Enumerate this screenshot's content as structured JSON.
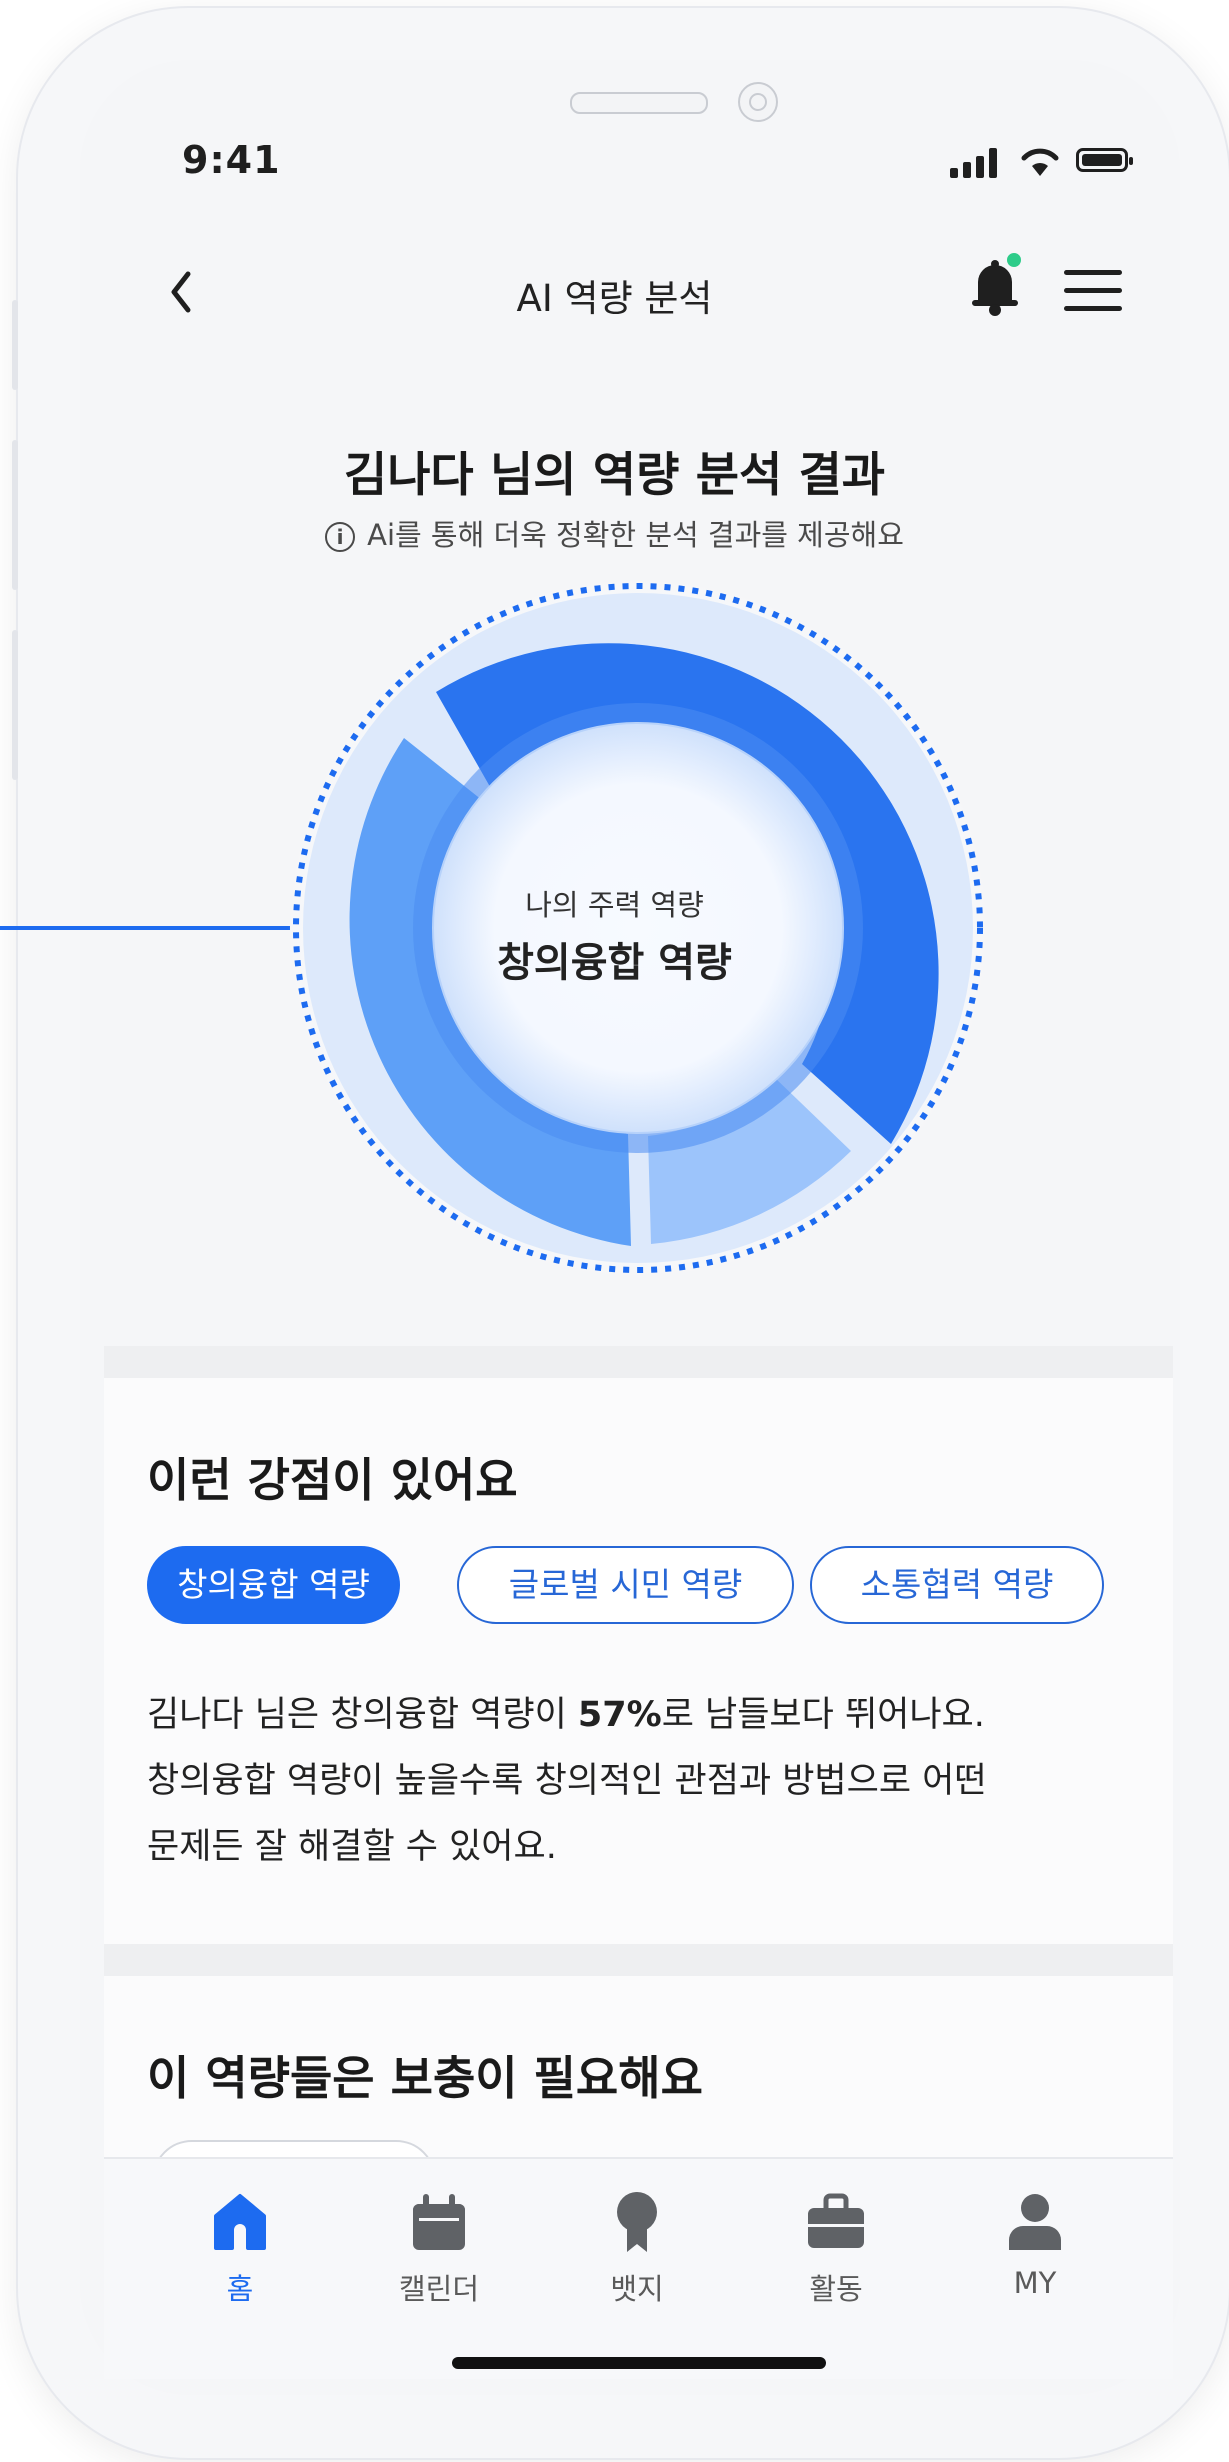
{
  "status_bar": {
    "time": "9:41"
  },
  "header": {
    "title": "AI 역량 분석"
  },
  "analysis": {
    "title": "김나다 님의 역량 분석 결과",
    "info_text": "Ai를 통해 더욱 정확한 분석 결과를 제공해요",
    "center_label_small": "나의 주력 역량",
    "center_label_big": "창의융합 역량"
  },
  "strengths": {
    "title": "이런 강점이 있어요",
    "chips": [
      "창의융합 역량",
      "글로벌 시민 역량",
      "소통협력 역량"
    ],
    "desc_before_bold": "김나다 님은 창의융합 역량이 ",
    "desc_bold": "57%",
    "desc_after_bold": "로 남들보다 뛰어나요.",
    "desc_line2": "창의융합 역량이 높을수록 창의적인 관점과 방법으로 어떤",
    "desc_line3": "문제든 잘 해결할 수 있어요."
  },
  "weakness": {
    "title": "이 역량들은 보충이 필요해요"
  },
  "tabbar": {
    "items": [
      {
        "label": "홈",
        "icon": "home-icon",
        "active": true
      },
      {
        "label": "캘린더",
        "icon": "calendar-icon",
        "active": false
      },
      {
        "label": "뱃지",
        "icon": "badge-icon",
        "active": false
      },
      {
        "label": "활동",
        "icon": "briefcase-icon",
        "active": false
      },
      {
        "label": "MY",
        "icon": "user-icon",
        "active": false
      }
    ]
  },
  "colors": {
    "accent": "#1d6bf0",
    "ring_dark": "#2a74ef",
    "ring_mid": "#5ea0f7",
    "ring_light": "#9cc4fb",
    "notification_dot": "#2ecc8a"
  }
}
